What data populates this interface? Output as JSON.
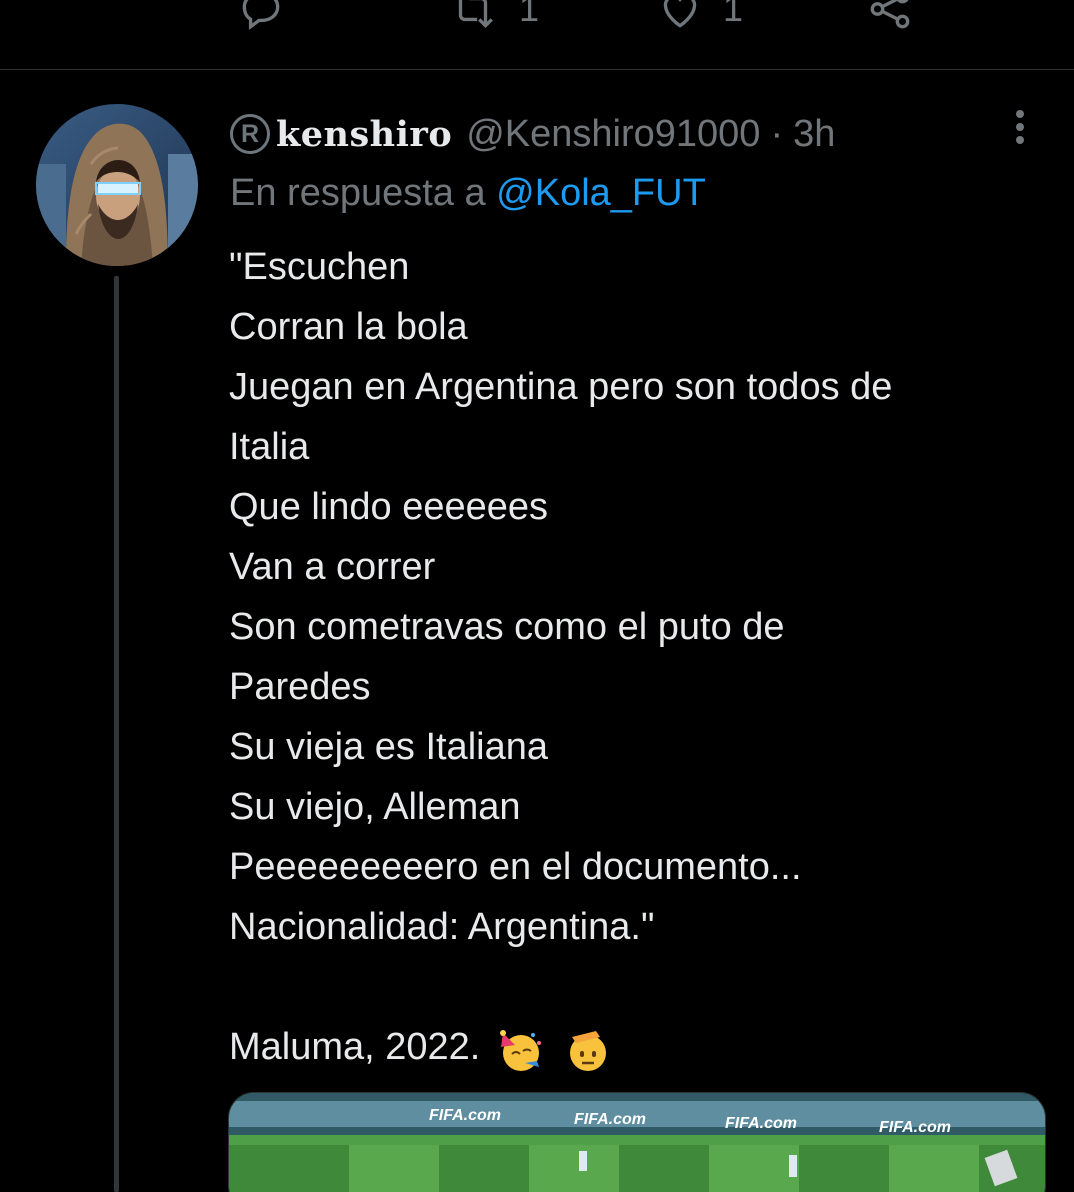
{
  "previous_tweet": {
    "retweet_count": "1",
    "like_count": "1"
  },
  "tweet": {
    "display_name": "kenshiro",
    "name_badge": "R",
    "handle": "@Kenshiro91000",
    "separator": "·",
    "time": "3h",
    "reply_prefix": "En respuesta a",
    "reply_mention": "@Kola_FUT",
    "lines": [
      "\"Escuchen",
      "Corran la bola",
      "Juegan en Argentina pero son todos de",
      "Italia",
      "Que lindo eeeeees",
      "Van a correr",
      "Son cometravas como el puto de",
      "Paredes",
      "Su vieja es Italiana",
      "Su viejo, Alleman",
      "Peeeeeeeeero en el documento...",
      "Nacionalidad: Argentina.\"",
      "",
      "Maluma, 2022."
    ],
    "emojis": [
      "partying-face-emoji",
      "saluting-face-emoji"
    ],
    "media": {
      "banner_texts": [
        "FIFA.com",
        "FIFA.com",
        "FIFA.com",
        "FIFA.com"
      ]
    }
  },
  "colors": {
    "background": "#000000",
    "text": "#e7e9ea",
    "muted": "#71767b",
    "link": "#1d9bf0",
    "divider": "#2f3336"
  }
}
